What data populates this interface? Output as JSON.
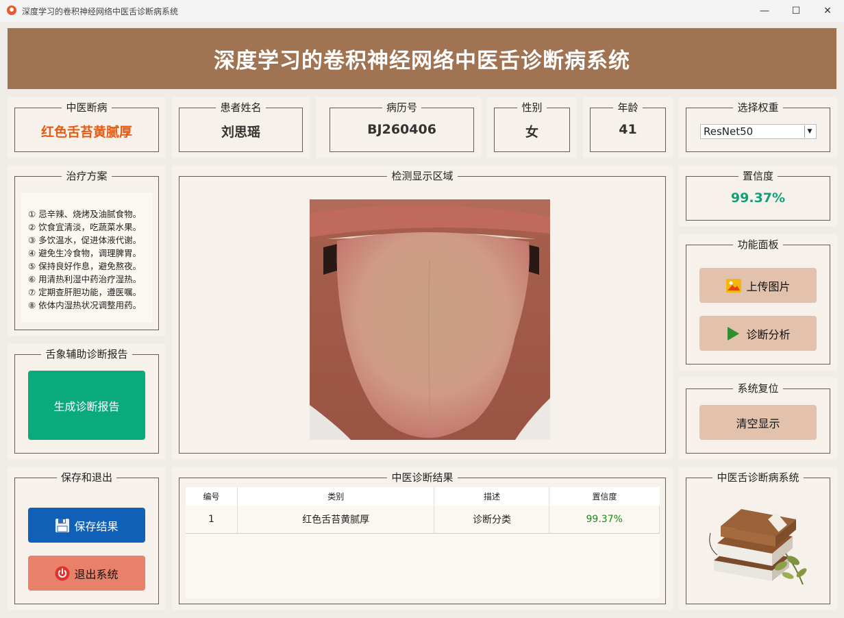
{
  "window": {
    "title": "深度学习的卷积神经网络中医舌诊断病系统",
    "minimize": "—",
    "maximize": "☐",
    "close": "✕"
  },
  "header": {
    "title": "深度学习的卷积神经网络中医舌诊断病系统"
  },
  "info": {
    "diagnosis": {
      "label": "中医断病",
      "value": "红色舌苔黄腻厚"
    },
    "patient_name": {
      "label": "患者姓名",
      "value": "刘思瑶"
    },
    "record_no": {
      "label": "病历号",
      "value": "BJ260406"
    },
    "gender": {
      "label": "性别",
      "value": "女"
    },
    "age": {
      "label": "年龄",
      "value": "41"
    },
    "weights": {
      "label": "选择权重",
      "selected": "ResNet50"
    }
  },
  "treatment": {
    "label": "治疗方案",
    "items": [
      "① 忌辛辣、烧烤及油腻食物。",
      "② 饮食宜清淡，吃蔬菜水果。",
      "③ 多饮温水，促进体液代谢。",
      "④ 避免生冷食物，调理脾胃。",
      "⑤ 保持良好作息，避免熬夜。",
      "⑥ 用清热利湿中药治疗湿热。",
      "⑦ 定期查肝胆功能，遵医嘱。",
      "⑧ 依体内湿热状况调整用药。"
    ]
  },
  "report": {
    "label": "舌象辅助诊断报告",
    "button": "生成诊断报告"
  },
  "save_exit": {
    "label": "保存和退出",
    "save": "保存结果",
    "exit": "退出系统"
  },
  "detection": {
    "label": "检测显示区域"
  },
  "confidence": {
    "label": "置信度",
    "value": "99.37%"
  },
  "functions": {
    "label": "功能面板",
    "upload": "上传图片",
    "analyze": "诊断分析"
  },
  "reset": {
    "label": "系统复位",
    "clear": "清空显示"
  },
  "results": {
    "label": "中医诊断结果",
    "columns": [
      "编号",
      "类别",
      "描述",
      "置信度"
    ],
    "rows": [
      [
        "1",
        "红色舌苔黄腻厚",
        "诊断分类",
        "99.37%"
      ]
    ]
  },
  "logo_panel": {
    "label": "中医舌诊断病系统"
  },
  "colors": {
    "header": "#a07353",
    "accent_orange": "#e85a12",
    "confidence_green": "#12a07a",
    "report_button": "#0aaa7c",
    "save_button": "#1060b8",
    "exit_button": "#e8806a",
    "func_button": "#e2c1ad"
  }
}
